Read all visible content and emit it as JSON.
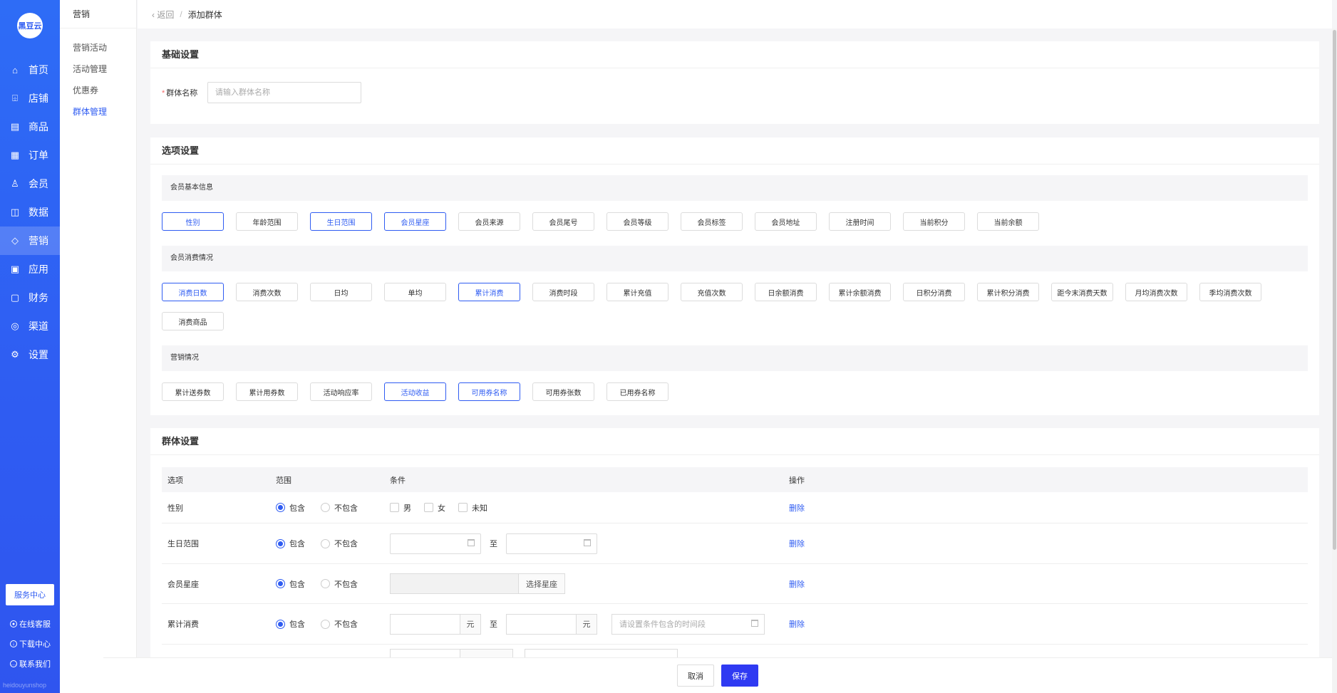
{
  "logo_text": "黑豆云",
  "nav": [
    {
      "label": "首页",
      "icon": "home-icon",
      "glyph": "⌂"
    },
    {
      "label": "店铺",
      "icon": "store-icon",
      "glyph": "⌹"
    },
    {
      "label": "商品",
      "icon": "goods-icon",
      "glyph": "▤"
    },
    {
      "label": "订单",
      "icon": "order-icon",
      "glyph": "▦"
    },
    {
      "label": "会员",
      "icon": "user-icon",
      "glyph": "♙"
    },
    {
      "label": "数据",
      "icon": "chart-icon",
      "glyph": "◫"
    },
    {
      "label": "营销",
      "icon": "tag-icon",
      "glyph": "◇",
      "active": true
    },
    {
      "label": "应用",
      "icon": "app-icon",
      "glyph": "▣"
    },
    {
      "label": "财务",
      "icon": "finance-icon",
      "glyph": "▢"
    },
    {
      "label": "渠道",
      "icon": "channel-icon",
      "glyph": "◎"
    },
    {
      "label": "设置",
      "icon": "gear-icon",
      "glyph": "⚙"
    }
  ],
  "service_center": "服务中心",
  "side_links": [
    "在线客服",
    "下载中心",
    "联系我们"
  ],
  "brand_footer": "heidouyunshop",
  "subnav": {
    "title": "营销",
    "items": [
      "营销活动",
      "活动管理",
      "优惠券",
      "群体管理"
    ]
  },
  "breadcrumb": {
    "back": "返回",
    "current": "添加群体"
  },
  "basic": {
    "title": "基础设置",
    "name_label": "群体名称",
    "name_placeholder": "请输入群体名称"
  },
  "options": {
    "title": "选项设置",
    "groups": [
      {
        "label": "会员基本信息",
        "tags": [
          {
            "text": "性别",
            "sel": true
          },
          {
            "text": "年龄范围",
            "sel": false
          },
          {
            "text": "生日范围",
            "sel": true
          },
          {
            "text": "会员星座",
            "sel": true
          },
          {
            "text": "会员来源",
            "sel": false
          },
          {
            "text": "会员尾号",
            "sel": false
          },
          {
            "text": "会员等级",
            "sel": false
          },
          {
            "text": "会员标签",
            "sel": false
          },
          {
            "text": "会员地址",
            "sel": false
          },
          {
            "text": "注册时间",
            "sel": false
          },
          {
            "text": "当前积分",
            "sel": false
          },
          {
            "text": "当前余额",
            "sel": false
          }
        ]
      },
      {
        "label": "会员消费情况",
        "tags": [
          {
            "text": "消费日数",
            "sel": true
          },
          {
            "text": "消费次数",
            "sel": false
          },
          {
            "text": "日均",
            "sel": false
          },
          {
            "text": "单均",
            "sel": false
          },
          {
            "text": "累计消费",
            "sel": true
          },
          {
            "text": "消费时段",
            "sel": false
          },
          {
            "text": "累计充值",
            "sel": false
          },
          {
            "text": "充值次数",
            "sel": false
          },
          {
            "text": "日余额消费",
            "sel": false
          },
          {
            "text": "累计余额消费",
            "sel": false
          },
          {
            "text": "日积分消费",
            "sel": false
          },
          {
            "text": "累计积分消费",
            "sel": false
          },
          {
            "text": "距今末消费天数",
            "sel": false
          },
          {
            "text": "月均消费次数",
            "sel": false
          },
          {
            "text": "季均消费次数",
            "sel": false
          },
          {
            "text": "消费商品",
            "sel": false
          }
        ]
      },
      {
        "label": "营销情况",
        "tags": [
          {
            "text": "累计送券数",
            "sel": false
          },
          {
            "text": "累计用券数",
            "sel": false
          },
          {
            "text": "活动响应率",
            "sel": false
          },
          {
            "text": "活动收益",
            "sel": true
          },
          {
            "text": "可用券名称",
            "sel": true
          },
          {
            "text": "可用券张数",
            "sel": false
          },
          {
            "text": "已用券名称",
            "sel": false
          }
        ]
      }
    ]
  },
  "group_settings": {
    "title": "群体设置",
    "headers": [
      "选项",
      "范围",
      "条件",
      "操作"
    ],
    "include": "包含",
    "exclude": "不包含",
    "delete": "删除",
    "to": "至",
    "rows": {
      "gender": {
        "label": "性别",
        "options": [
          "男",
          "女",
          "未知"
        ]
      },
      "birthday": {
        "label": "生日范围"
      },
      "zodiac": {
        "label": "会员星座",
        "button": "选择星座"
      },
      "spend": {
        "label": "累计消费",
        "unit": "元",
        "time_placeholder": "请设置条件包含的时间段"
      }
    }
  },
  "footer": {
    "cancel": "取消",
    "save": "保存"
  }
}
